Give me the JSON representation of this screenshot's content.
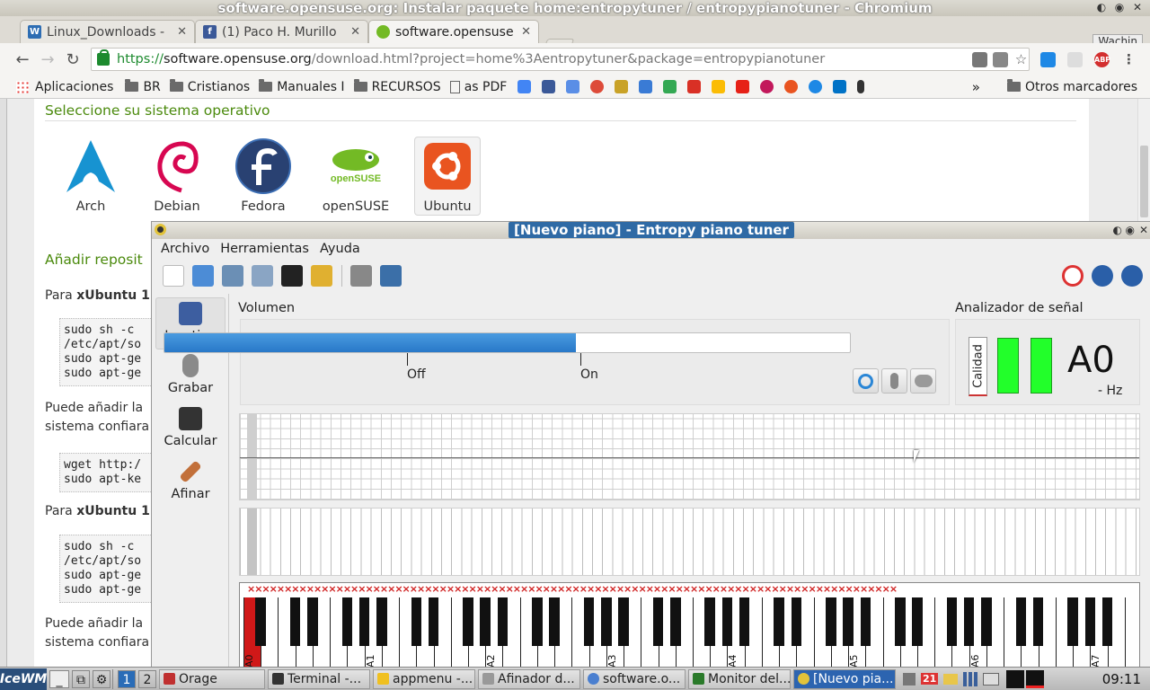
{
  "browser": {
    "window_title": "software.opensuse.org: Instalar paquete home:entropytuner / entropypianotuner - Chromium",
    "user": "Wachin",
    "tabs": [
      {
        "label": "Linux_Downloads -",
        "color": "#2d6db3"
      },
      {
        "label": "(1) Paco H. Murillo",
        "color": "#3b5998"
      },
      {
        "label": "software.opensuse",
        "color": "#73ba25"
      }
    ],
    "url": {
      "scheme": "https://",
      "host": "software.opensuse.org",
      "path": "/download.html?project=home%3Aentropytuner&package=entropypianotuner"
    },
    "bookmarks": {
      "apps": "Aplicaciones",
      "folders": [
        "BR",
        "Cristianos",
        "Manuales I",
        "RECURSOS"
      ],
      "pdf": "as PDF",
      "overflow": "»",
      "other": "Otros marcadores"
    }
  },
  "webpage": {
    "os_heading": "Seleccione su sistema operativo",
    "os_list": [
      "Arch",
      "Debian",
      "Fedora",
      "openSUSE",
      "Ubuntu"
    ],
    "add_repo_heading": "Añadir reposit",
    "para1_prefix": "Para ",
    "para1_bold": "xUbuntu 1",
    "code1": [
      "sudo sh -c",
      "/etc/apt/so",
      "sudo apt-ge",
      "sudo apt-ge"
    ],
    "para2": [
      "Puede añadir la",
      "sistema confiara"
    ],
    "code2": [
      "wget http:/",
      "sudo apt-ke"
    ],
    "para3_prefix": "Para ",
    "para3_bold": "xUbuntu 1",
    "code3": [
      "sudo sh -c",
      "/etc/apt/so",
      "sudo apt-ge",
      "sudo apt-ge"
    ],
    "para4": [
      "Puede añadir la",
      "sistema confiara"
    ]
  },
  "tuner": {
    "title": "[Nuevo piano] - Entropy piano tuner",
    "menu": [
      "Archivo",
      "Herramientas",
      "Ayuda"
    ],
    "modes": [
      "Inactive",
      "Grabar",
      "Calcular",
      "Afinar"
    ],
    "volume": {
      "label": "Volumen",
      "level_percent": 60,
      "off_label": "Off",
      "on_label": "On"
    },
    "analyzer": {
      "label": "Analizador de señal",
      "quality_label": "Calidad",
      "note": "A0",
      "hz_label": "- Hz"
    },
    "keyboard": {
      "labels": [
        "A0",
        "A1",
        "A2",
        "A3",
        "A4",
        "A5",
        "A6",
        "A7"
      ],
      "selected_key": "A0",
      "selected_color": "#d01818"
    }
  },
  "taskbar": {
    "start": "IceWM",
    "workspaces": [
      "1",
      "2"
    ],
    "tasks": [
      {
        "label": "Orage",
        "color": "#c03030"
      },
      {
        "label": "Terminal -...",
        "color": "#333"
      },
      {
        "label": "appmenu -...",
        "color": "#f0c020"
      },
      {
        "label": "Afinador d...",
        "color": "#999"
      },
      {
        "label": "software.o...",
        "color": "#4a7fd0"
      },
      {
        "label": "Monitor del...",
        "color": "#2a7a2a"
      },
      {
        "label": "[Nuevo pia...",
        "color": "#2a4e7a"
      }
    ],
    "calendar_day": "21",
    "clock": "09:11"
  }
}
